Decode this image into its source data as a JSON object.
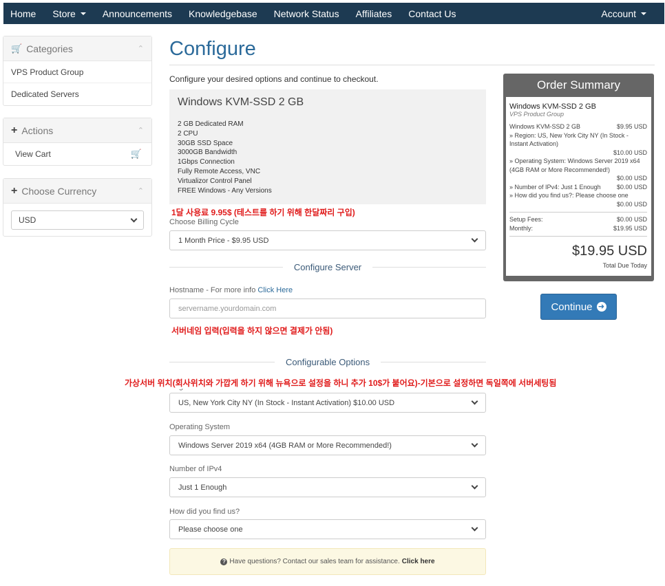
{
  "nav": {
    "home": "Home",
    "store": "Store",
    "announcements": "Announcements",
    "knowledgebase": "Knowledgebase",
    "network_status": "Network Status",
    "affiliates": "Affiliates",
    "contact": "Contact Us",
    "account": "Account"
  },
  "sidebar": {
    "categories": {
      "title": "Categories",
      "items": [
        "VPS Product Group",
        "Dedicated Servers"
      ]
    },
    "actions": {
      "title": "Actions",
      "view_cart": "View Cart"
    },
    "currency": {
      "title": "Choose Currency",
      "selected": "USD"
    }
  },
  "main": {
    "title": "Configure",
    "intro": "Configure your desired options and continue to checkout.",
    "product": {
      "name": "Windows KVM-SSD 2 GB",
      "specs": [
        "2 GB Dedicated RAM",
        "2 CPU",
        "30GB SSD Space",
        "3000GB Bandwidth",
        "1Gbps Connection",
        "Fully Remote Access, VNC",
        "Virtualizor Control Panel",
        "FREE Windows - Any Versions"
      ]
    },
    "billing_label": "Choose Billing Cycle",
    "billing_value": "1 Month Price - $9.95 USD",
    "configure_server_heading": "Configure Server",
    "hostname_label": "Hostname - For more info ",
    "hostname_link": "Click Here",
    "hostname_placeholder": "servername.yourdomain.com",
    "configurable_options_heading": "Configurable Options",
    "region_label": "Region",
    "region_value": "US, New York City NY (In Stock - Instant Activation) $10.00 USD",
    "os_label": "Operating System",
    "os_value": "Windows Server 2019 x64 (4GB RAM or More Recommended!)",
    "ipv4_label": "Number of IPv4",
    "ipv4_value": "Just 1 Enough",
    "find_label": "How did you find us?",
    "find_value": "Please choose one",
    "help_text": "Have questions? Contact our sales team for assistance.",
    "help_link": "Click here"
  },
  "annotations": {
    "billing_note": "1달 사용료 9.95$ (테스트를 하기 위해 한달짜리 구입)",
    "hostname_note": "서버네임 입력(입력을 하지 않으면 결제가 안됨)",
    "region_note": "가상서버 위치(회사위치와 가깝게 하기 위해 뉴욕으로 설정을 하니 추가 10$가 붙어요)-기본으로 설정하면 독일쪽에 서버세팅됨"
  },
  "summary": {
    "title": "Order Summary",
    "product_name": "Windows KVM-SSD 2 GB",
    "product_group": "VPS Product Group",
    "base_label": "Windows KVM-SSD 2 GB",
    "base_price": "$9.95 USD",
    "region_note": "» Region: US, New York City NY (In Stock - Instant Activation)",
    "region_price": "$10.00 USD",
    "os_note": "» Operating System: Windows Server 2019 x64 (4GB RAM or More Recommended!)",
    "os_price": "$0.00 USD",
    "ipv4_note": "» Number of IPv4: Just 1 Enough",
    "ipv4_price": "$0.00 USD",
    "find_note": "» How did you find us?: Please choose one",
    "find_price": "$0.00 USD",
    "setup_label": "Setup Fees:",
    "setup_value": "$0.00 USD",
    "monthly_label": "Monthly:",
    "monthly_value": "$19.95 USD",
    "total": "$19.95 USD",
    "total_due_label": "Total Due Today"
  },
  "continue_label": "Continue",
  "colors": {
    "navbar": "#1d3a52",
    "title": "#2b6a9a",
    "annotation": "#e01b1b",
    "button": "#337ab7"
  }
}
